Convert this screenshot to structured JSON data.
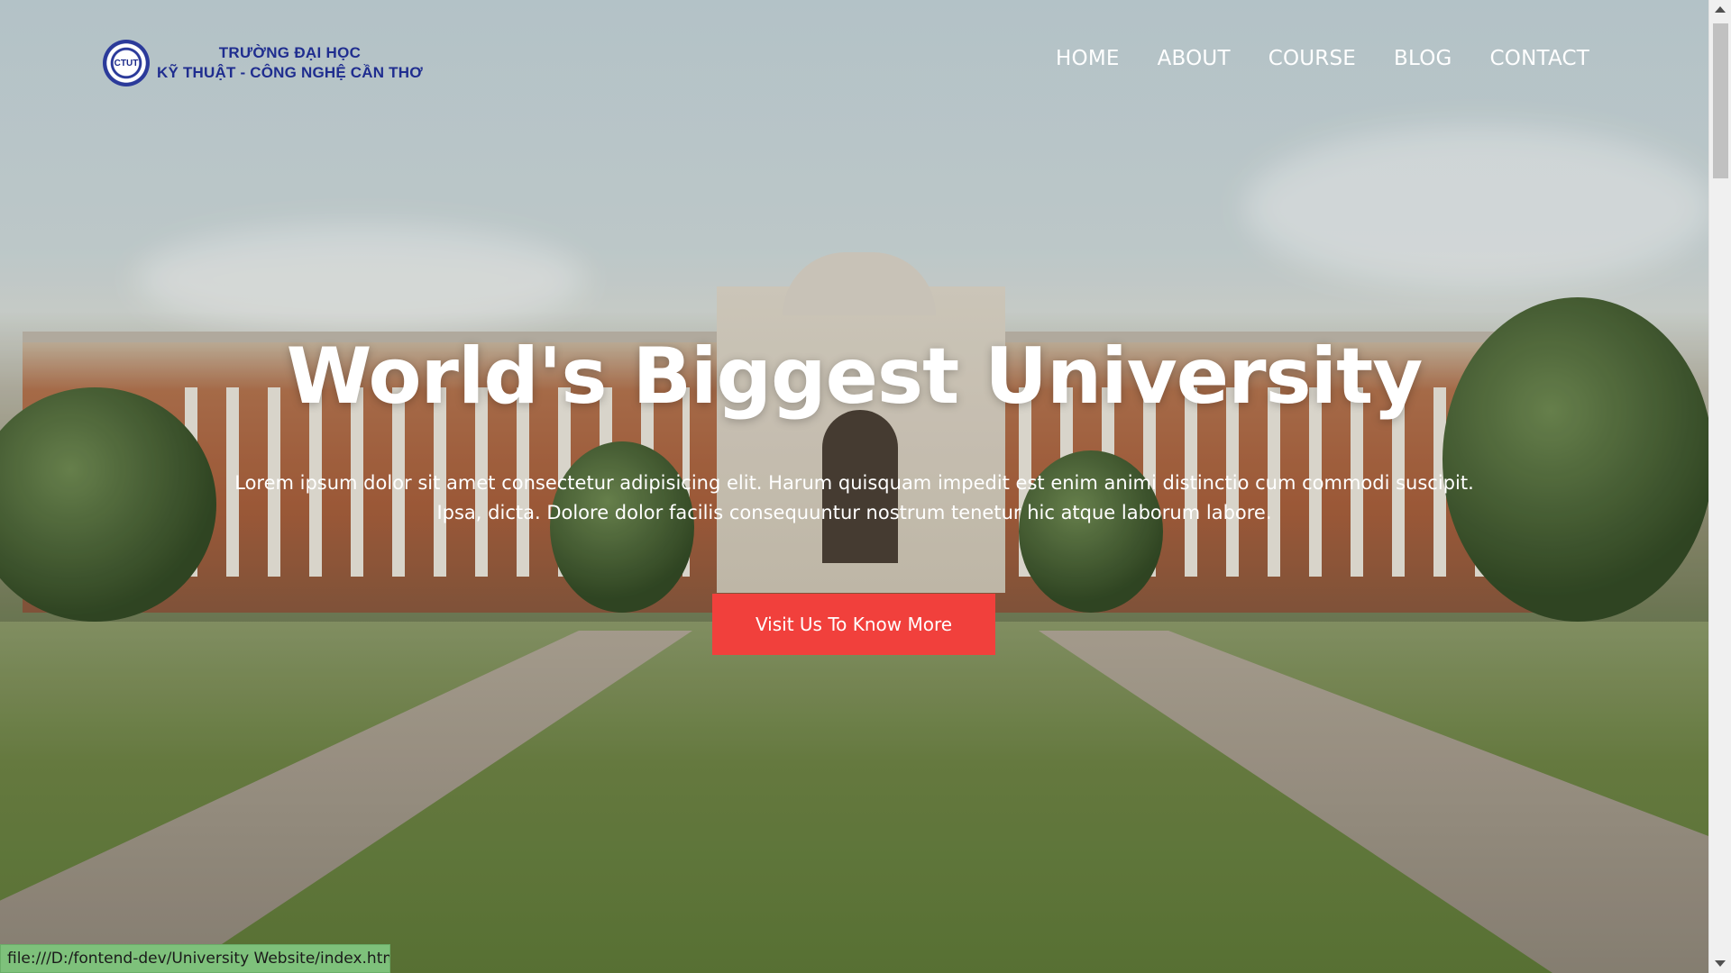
{
  "logo": {
    "seal_text": "CTUT",
    "line1": "TRƯỜNG ĐẠI HỌC",
    "line2": "KỸ THUẬT - CÔNG NGHỆ CẦN THƠ"
  },
  "nav": {
    "items": [
      {
        "label": "HOME"
      },
      {
        "label": "ABOUT"
      },
      {
        "label": "COURSE"
      },
      {
        "label": "BLOG"
      },
      {
        "label": "CONTACT"
      }
    ]
  },
  "hero": {
    "title": "World's Biggest University",
    "subtitle_line1": "Lorem ipsum dolor sit amet consectetur adipisicing elit. Harum quisquam impedit est enim animi distinctio cum commodi suscipit.",
    "subtitle_line2": "Ipsa, dicta. Dolore dolor facilis consequuntur nostrum tenetur hic atque laborum labore.",
    "cta_label": "Visit Us To Know More"
  },
  "status_bar": {
    "url": "file:///D:/fontend-dev/University Website/index.html"
  },
  "colors": {
    "cta_background": "#f1403c",
    "status_background": "#7ec17b",
    "logo_text": "#1f2d8f"
  }
}
